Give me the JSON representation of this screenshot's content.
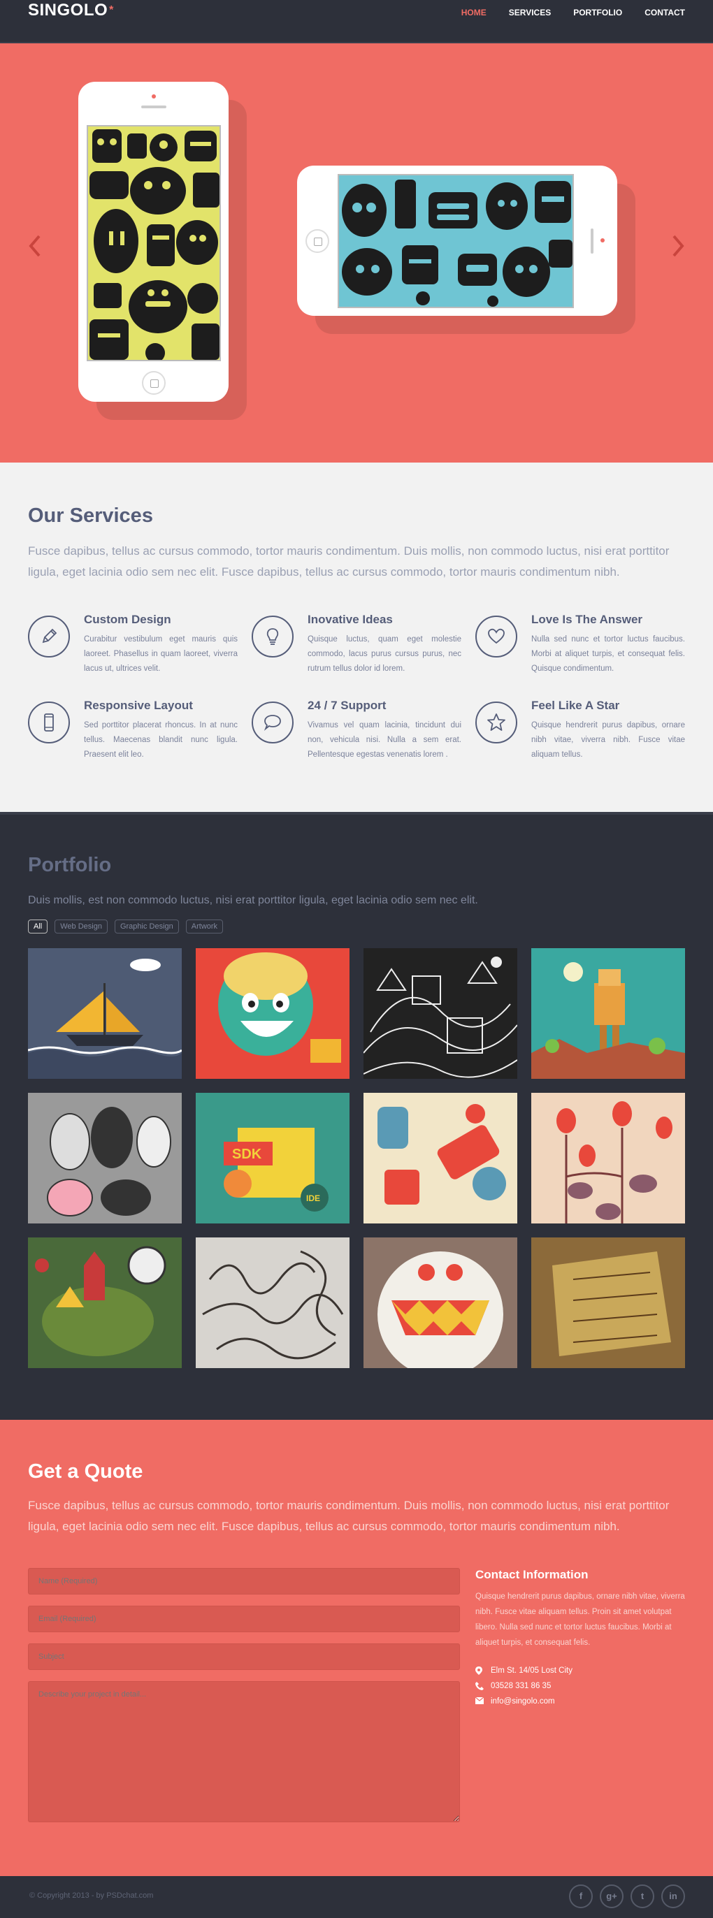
{
  "header": {
    "logo": "SINGOLO",
    "logo_mark": "*",
    "nav": [
      {
        "label": "HOME",
        "active": true
      },
      {
        "label": "SERVICES",
        "active": false
      },
      {
        "label": "PORTFOLIO",
        "active": false
      },
      {
        "label": "CONTACT",
        "active": false
      }
    ]
  },
  "slider": {
    "prev_icon": "chevron-left-icon",
    "next_icon": "chevron-right-icon"
  },
  "services": {
    "title": "Our Services",
    "lead": "Fusce dapibus, tellus ac cursus commodo, tortor mauris condimentum. Duis mollis, non commodo luctus, nisi erat porttitor ligula, eget lacinia odio sem nec elit. Fusce dapibus, tellus ac cursus commodo, tortor mauris condimentum nibh.",
    "items": [
      {
        "icon": "pencil-icon",
        "title": "Custom Design",
        "desc": "Curabitur vestibulum eget mauris quis laoreet. Phasellus in quam laoreet, viverra lacus ut, ultrices velit."
      },
      {
        "icon": "lightbulb-icon",
        "title": "Inovative Ideas",
        "desc": "Quisque luctus, quam eget molestie commodo, lacus purus cursus purus, nec rutrum tellus dolor id lorem."
      },
      {
        "icon": "heart-icon",
        "title": "Love Is The Answer",
        "desc": "Nulla sed nunc et tortor luctus faucibus. Morbi at aliquet turpis, et consequat felis. Quisque condimentum."
      },
      {
        "icon": "phone-icon",
        "title": "Responsive Layout",
        "desc": "Sed porttitor placerat rhoncus. In at nunc tellus. Maecenas blandit nunc ligula. Praesent elit leo."
      },
      {
        "icon": "chat-bubble-icon",
        "title": "24 / 7 Support",
        "desc": "Vivamus vel quam lacinia, tincidunt dui non, vehicula nisi. Nulla a sem erat. Pellentesque egestas venenatis lorem ."
      },
      {
        "icon": "star-icon",
        "title": "Feel Like A Star",
        "desc": "Quisque hendrerit purus dapibus, ornare nibh vitae, viverra nibh. Fusce vitae aliquam tellus."
      }
    ]
  },
  "portfolio": {
    "title": "Portfolio",
    "lead": "Duis mollis, est non commodo luctus, nisi erat porttitor ligula, eget lacinia odio sem nec elit.",
    "tags": [
      {
        "label": "All",
        "active": true
      },
      {
        "label": "Web Design",
        "active": false
      },
      {
        "label": "Graphic Design",
        "active": false
      },
      {
        "label": "Artwork",
        "active": false
      }
    ],
    "works": [
      {
        "name": "sailboat-artwork",
        "bg": "#4e5b74"
      },
      {
        "name": "smiling-character-artwork",
        "bg": "#e8483b"
      },
      {
        "name": "monochrome-city-artwork",
        "bg": "#222222"
      },
      {
        "name": "robot-desert-artwork",
        "bg": "#3aa8a0"
      },
      {
        "name": "doodle-creatures-artwork",
        "bg": "#9a9a9a"
      },
      {
        "name": "sdk-collage-artwork",
        "bg": "#3a9a8a"
      },
      {
        "name": "robots-pattern-artwork",
        "bg": "#f2e6c8"
      },
      {
        "name": "birds-branches-artwork",
        "bg": "#f1d6be"
      },
      {
        "name": "castle-monster-artwork",
        "bg": "#4a6a3a"
      },
      {
        "name": "calligraphy-artwork",
        "bg": "#d7d4cf"
      },
      {
        "name": "white-monster-artwork",
        "bg": "#8c7468"
      },
      {
        "name": "paper-texture-artwork",
        "bg": "#8c6a3a"
      }
    ]
  },
  "quote": {
    "title": "Get a Quote",
    "lead": "Fusce dapibus, tellus ac cursus commodo, tortor mauris condimentum. Duis mollis, non commodo luctus, nisi erat porttitor ligula, eget lacinia odio sem nec elit. Fusce dapibus, tellus ac cursus commodo, tortor mauris condimentum nibh.",
    "form": {
      "name_placeholder": "Name (Required)",
      "email_placeholder": "Email (Required)",
      "subject_placeholder": "Subject",
      "message_placeholder": "Describe your project in detail..."
    },
    "contact": {
      "title": "Contact Information",
      "desc": "Quisque hendrerit purus dapibus, ornare nibh vitae, viverra nibh. Fusce vitae aliquam tellus. Proin sit amet volutpat libero. Nulla sed nunc et tortor luctus faucibus. Morbi at aliquet turpis, et consequat felis.",
      "address": "Elm St. 14/05 Lost City",
      "phone": "03528 331 86 35",
      "email": "info@singolo.com"
    }
  },
  "footer": {
    "copyright": "© Copyright 2013 - by PSDchat.com",
    "socials": [
      {
        "icon": "facebook-icon",
        "glyph": "f"
      },
      {
        "icon": "google-plus-icon",
        "glyph": "g+"
      },
      {
        "icon": "twitter-icon",
        "glyph": "t"
      },
      {
        "icon": "linkedin-icon",
        "glyph": "in"
      }
    ]
  },
  "colors": {
    "accent": "#f06c64",
    "dark": "#2d303a",
    "light": "#f2f2f2",
    "heading": "#555d79"
  }
}
